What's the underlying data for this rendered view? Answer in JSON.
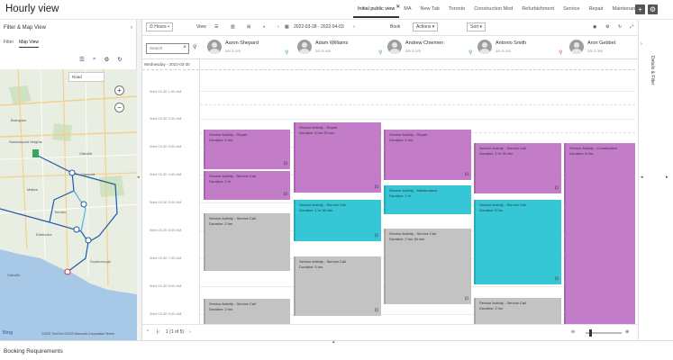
{
  "app": {
    "title": "Hourly view"
  },
  "tabs": [
    {
      "label": "Initial public view",
      "active": true,
      "closable": true
    },
    {
      "label": "MA",
      "active": false
    },
    {
      "label": "New Tab",
      "active": false
    },
    {
      "label": "Toronto",
      "active": false
    },
    {
      "label": "Construction Mod",
      "active": false
    },
    {
      "label": "Refurbishment",
      "active": false
    },
    {
      "label": "Service",
      "active": false
    },
    {
      "label": "Repair",
      "active": false
    },
    {
      "label": "Maintenance",
      "active": false
    }
  ],
  "top_buttons": {
    "add": "+",
    "settings": "⚙"
  },
  "filter_panel": {
    "title": "Filter & Map View",
    "tabs": [
      {
        "label": "Filter",
        "active": false
      },
      {
        "label": "Map View",
        "active": true
      }
    ],
    "map_legend_label": "Road",
    "bing": "Bing",
    "copyright": "©2022 TomTom ©2022 Microsoft Corporation Terms"
  },
  "toolbar": {
    "view": "Hours",
    "view_sub": "View",
    "date_range": "2022-03-28 - 2022-04-03",
    "book": "Book",
    "actions": "Actions",
    "sort": "Sort"
  },
  "search": {
    "placeholder": "Search"
  },
  "resources": [
    {
      "name": "Aaron Shepard",
      "meta": "3/5 ⊙    2/5"
    },
    {
      "name": "Adam Williams",
      "meta": "2/5 ⊙    4/5"
    },
    {
      "name": "Andrew Chiemen",
      "meta": "3/5 ⊙    2/5"
    },
    {
      "name": "Antonio Smith",
      "meta": "4/5 ⊙    2/5"
    },
    {
      "name": "Aron Gebbet",
      "meta": "2/5 ⊙    3/5"
    }
  ],
  "day_label": "Wednesday - 2022-03-30",
  "time_labels": [
    "Wed 03-30    1:00 AM",
    "Wed 03-30    2:00 AM",
    "Wed 03-30    3:00 AM",
    "Wed 03-30    4:00 AM",
    "Wed 03-30    5:00 AM",
    "Wed 03-30    6:00 AM",
    "Wed 03-30    7:00 AM",
    "Wed 03-30    8:00 AM",
    "Wed 03-30    9:00 AM"
  ],
  "bookings": [
    {
      "title": "Service Activity - Repair",
      "detail": "Duration: 4 hrs",
      "color": "purple"
    },
    {
      "title": "Service Activity - Service Call",
      "detail": "Duration: 1 hr",
      "color": "purple"
    },
    {
      "title": "Service Activity - Service Call",
      "detail": "Duration: 2 hrs",
      "color": "grey"
    },
    {
      "title": "Service Activity - Repair",
      "detail": "Duration: 5 hrs 30 min",
      "color": "purple"
    },
    {
      "title": "Service Activity - Service Call",
      "detail": "Duration: 1 hr 30 min",
      "color": "cyan"
    },
    {
      "title": "Service Activity - Service Call",
      "detail": "Duration: 5 hrs",
      "color": "grey"
    },
    {
      "title": "Service Activity - Repair",
      "detail": "Duration: 4 hrs",
      "color": "purple"
    },
    {
      "title": "Service Activity - Maintenance",
      "detail": "Duration: 1 hr",
      "color": "cyan"
    },
    {
      "title": "Service Activity - Service Call",
      "detail": "Duration: 2 hrs 30 min",
      "color": "grey"
    },
    {
      "title": "Service Activity - Service Call",
      "detail": "Duration: 1 hr 30 min",
      "color": "purple"
    },
    {
      "title": "Service Activity - Service Call",
      "detail": "Duration: 5 hrs",
      "color": "cyan"
    },
    {
      "title": "Service Activity - Service Call",
      "detail": "Duration: 2 hrs",
      "color": "grey"
    },
    {
      "title": "Service Activity - Construction",
      "detail": "Duration: 8 hrs",
      "color": "purple"
    }
  ],
  "pager": {
    "page": "1 (1 of 5)"
  },
  "right_panel": {
    "label": "Details & Filter"
  },
  "footer": {
    "label": "Booking Requirements"
  },
  "colors": {
    "purple": "#c27cc8",
    "cyan": "#35c7d6",
    "grey": "#c3c3c3"
  }
}
